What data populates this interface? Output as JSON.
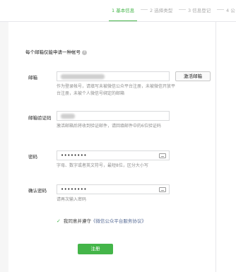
{
  "steps": [
    {
      "label": "1 基本信息"
    },
    {
      "label": "2 选择类型"
    },
    {
      "label": "3 信息登记"
    },
    {
      "label": "4 公"
    }
  ],
  "notice": "每个邮箱仅能申请一种帐号",
  "email": {
    "label": "邮箱",
    "hint": "作为登录帐号，请填写未被微信公众平台注册，未被微信开放平台注册，未被个人微信号绑定的邮箱",
    "activate_button": "激活邮箱"
  },
  "verify_code": {
    "label": "邮箱验证码",
    "hint": "激活邮箱后将收到验证邮件，请回填邮件中的6位验证码"
  },
  "password": {
    "label": "密码",
    "value": "••••••••",
    "hint": "字母、数字或者英文符号，最短8位，区分大小写"
  },
  "confirm_password": {
    "label": "确认密码",
    "value": "••••••••",
    "hint": "请再次输入密码"
  },
  "agreement": {
    "prefix": "我同意并遵守",
    "link": "《微信公众平台服务协议》"
  },
  "register_button": "注册",
  "colors": {
    "accent": "#44b549",
    "link": "#576b95"
  }
}
